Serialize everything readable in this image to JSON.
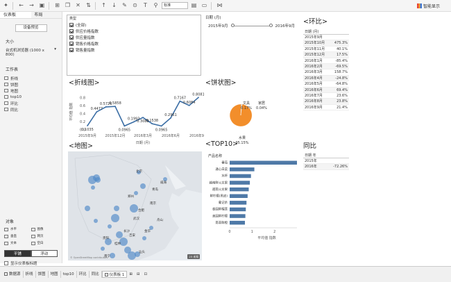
{
  "toolbar": {
    "view_select": "标准",
    "brand": "智能显示"
  },
  "sidebar": {
    "tab_dashboard": "仪表板",
    "tab_layout": "布局",
    "preview_button": "设备预览",
    "size_label": "大小",
    "size_value": "台式机浏览器 (1000 x 800)",
    "worksheets_label": "工作表",
    "worksheets": [
      "折线",
      "饼图",
      "地图",
      "top10",
      "环比",
      "同比"
    ],
    "objects_label": "对象",
    "objects": [
      "水平",
      "图像",
      "垂直",
      "网页",
      "文本",
      "空白"
    ],
    "tiled": "平铺",
    "floating": "浮动",
    "show_title": "显示仪表板标题"
  },
  "filter": {
    "title": "类型",
    "items": [
      "(全部)",
      "供应价格指数",
      "供应量指数",
      "销售价格指数",
      "销售量指数"
    ]
  },
  "date_filter": {
    "title": "日期 (月)",
    "start": "2015年9月",
    "end": "2016年9月"
  },
  "line_chart_title": "<折线图>",
  "pie_chart_title": "<饼状图>",
  "map_title": "<地图>",
  "top10_title": "<TOP10>",
  "mom_title": "<环比>",
  "yoy_title": "同比",
  "mom_table": {
    "header": "日期 (月)",
    "rows": [
      {
        "month": "2015年9月",
        "value": ""
      },
      {
        "month": "2015年10月",
        "value": "475.3%"
      },
      {
        "month": "2015年11月",
        "value": "40.1%"
      },
      {
        "month": "2015年12月",
        "value": "17.5%"
      },
      {
        "month": "2016年1月",
        "value": "-85.4%"
      },
      {
        "month": "2016年2月",
        "value": "-69.5%"
      },
      {
        "month": "2016年3月",
        "value": "158.7%"
      },
      {
        "month": "2016年4月",
        "value": "-24.8%"
      },
      {
        "month": "2016年5月",
        "value": "-64.8%"
      },
      {
        "month": "2016年6月",
        "value": "69.4%"
      },
      {
        "month": "2016年7月",
        "value": "23.6%"
      },
      {
        "month": "2016年8月",
        "value": "23.8%"
      },
      {
        "month": "2016年9月",
        "value": "21.4%"
      }
    ]
  },
  "yoy_table": {
    "header": "日期 年",
    "rows": [
      {
        "year": "2015年",
        "value": ""
      },
      {
        "year": "2016年",
        "value": "-72.26%"
      }
    ]
  },
  "map": {
    "cities": [
      "北京",
      "威海",
      "青岛",
      "郑州",
      "南京",
      "合肥",
      "武汉",
      "舟山",
      "长沙",
      "金华",
      "吉安",
      "贵阳",
      "桂林",
      "汕头",
      "南宁"
    ],
    "attribution": "© OpenStreetMap contributors",
    "badge": "23 未知"
  },
  "chart_data": [
    {
      "type": "line",
      "x": [
        "2015年9月",
        "2015年10月",
        "2015年11月",
        "2015年12月",
        "2016年1月",
        "2016年2月",
        "2016年3月",
        "2016年4月",
        "2016年5月",
        "2016年6月",
        "2016年7月",
        "2016年8月",
        "2016年9月"
      ],
      "values": [
        0.1035,
        0.4477,
        0.5726,
        0.5858,
        0.0965,
        0.1993,
        0.3082,
        0.1538,
        0.0965,
        0.2961,
        0.7167,
        0.6084,
        0.8081
      ],
      "value_labels": [
        "0.1035",
        "0.4477",
        "0.5726",
        "0.5858",
        "0.0965",
        "0.1993",
        "0.3082",
        "0.1538",
        "0.0965",
        "0.2961",
        "0.7167",
        "0.6084",
        "0.8081"
      ],
      "x_tick_labels": [
        "2015年9月",
        "2015年12月",
        "2016年3月",
        "2016年6月",
        "2016年9月"
      ],
      "y_ticks": [
        "0.8",
        "0.6",
        "0.4",
        "0.2",
        "0.0"
      ],
      "ylim": [
        0,
        0.9
      ],
      "xlabel": "日期 (月)",
      "ylabel": "平均值 指数",
      "color": "#3b6ea5"
    },
    {
      "type": "pie",
      "slices": [
        {
          "label": "文具",
          "value": 0.17,
          "display": "0.17%",
          "color": "#6f8fb0"
        },
        {
          "label": "家居",
          "value": 0.04,
          "display": "0.04%",
          "color": "#7fb3d5"
        },
        {
          "label": "水果",
          "value": 95.15,
          "display": "95.15%",
          "color": "#f28e2b"
        }
      ]
    },
    {
      "type": "bar",
      "orientation": "horizontal",
      "title": "产品名称",
      "categories": [
        "番茄",
        "通心白菜",
        "水杯",
        "越南鲜火龙果",
        "越南火龙果",
        "鲜柠檬(黑皮)",
        "葡记杀",
        "泰国鲜榴莲",
        "美国鲜柠檬",
        "南非鲜橙"
      ],
      "values": [
        3.0,
        1.1,
        0.95,
        0.9,
        0.85,
        0.8,
        0.75,
        0.72,
        0.7,
        0.68
      ],
      "xticks": [
        "0",
        "1",
        "2"
      ],
      "xlim": [
        0,
        3
      ],
      "xlabel": "平均值 指数",
      "color": "#4e79a7"
    }
  ],
  "bottom_tabs": [
    "数据源",
    "折线",
    "饼图",
    "地图",
    "top10",
    "环比",
    "同比",
    "仪表板 1"
  ]
}
